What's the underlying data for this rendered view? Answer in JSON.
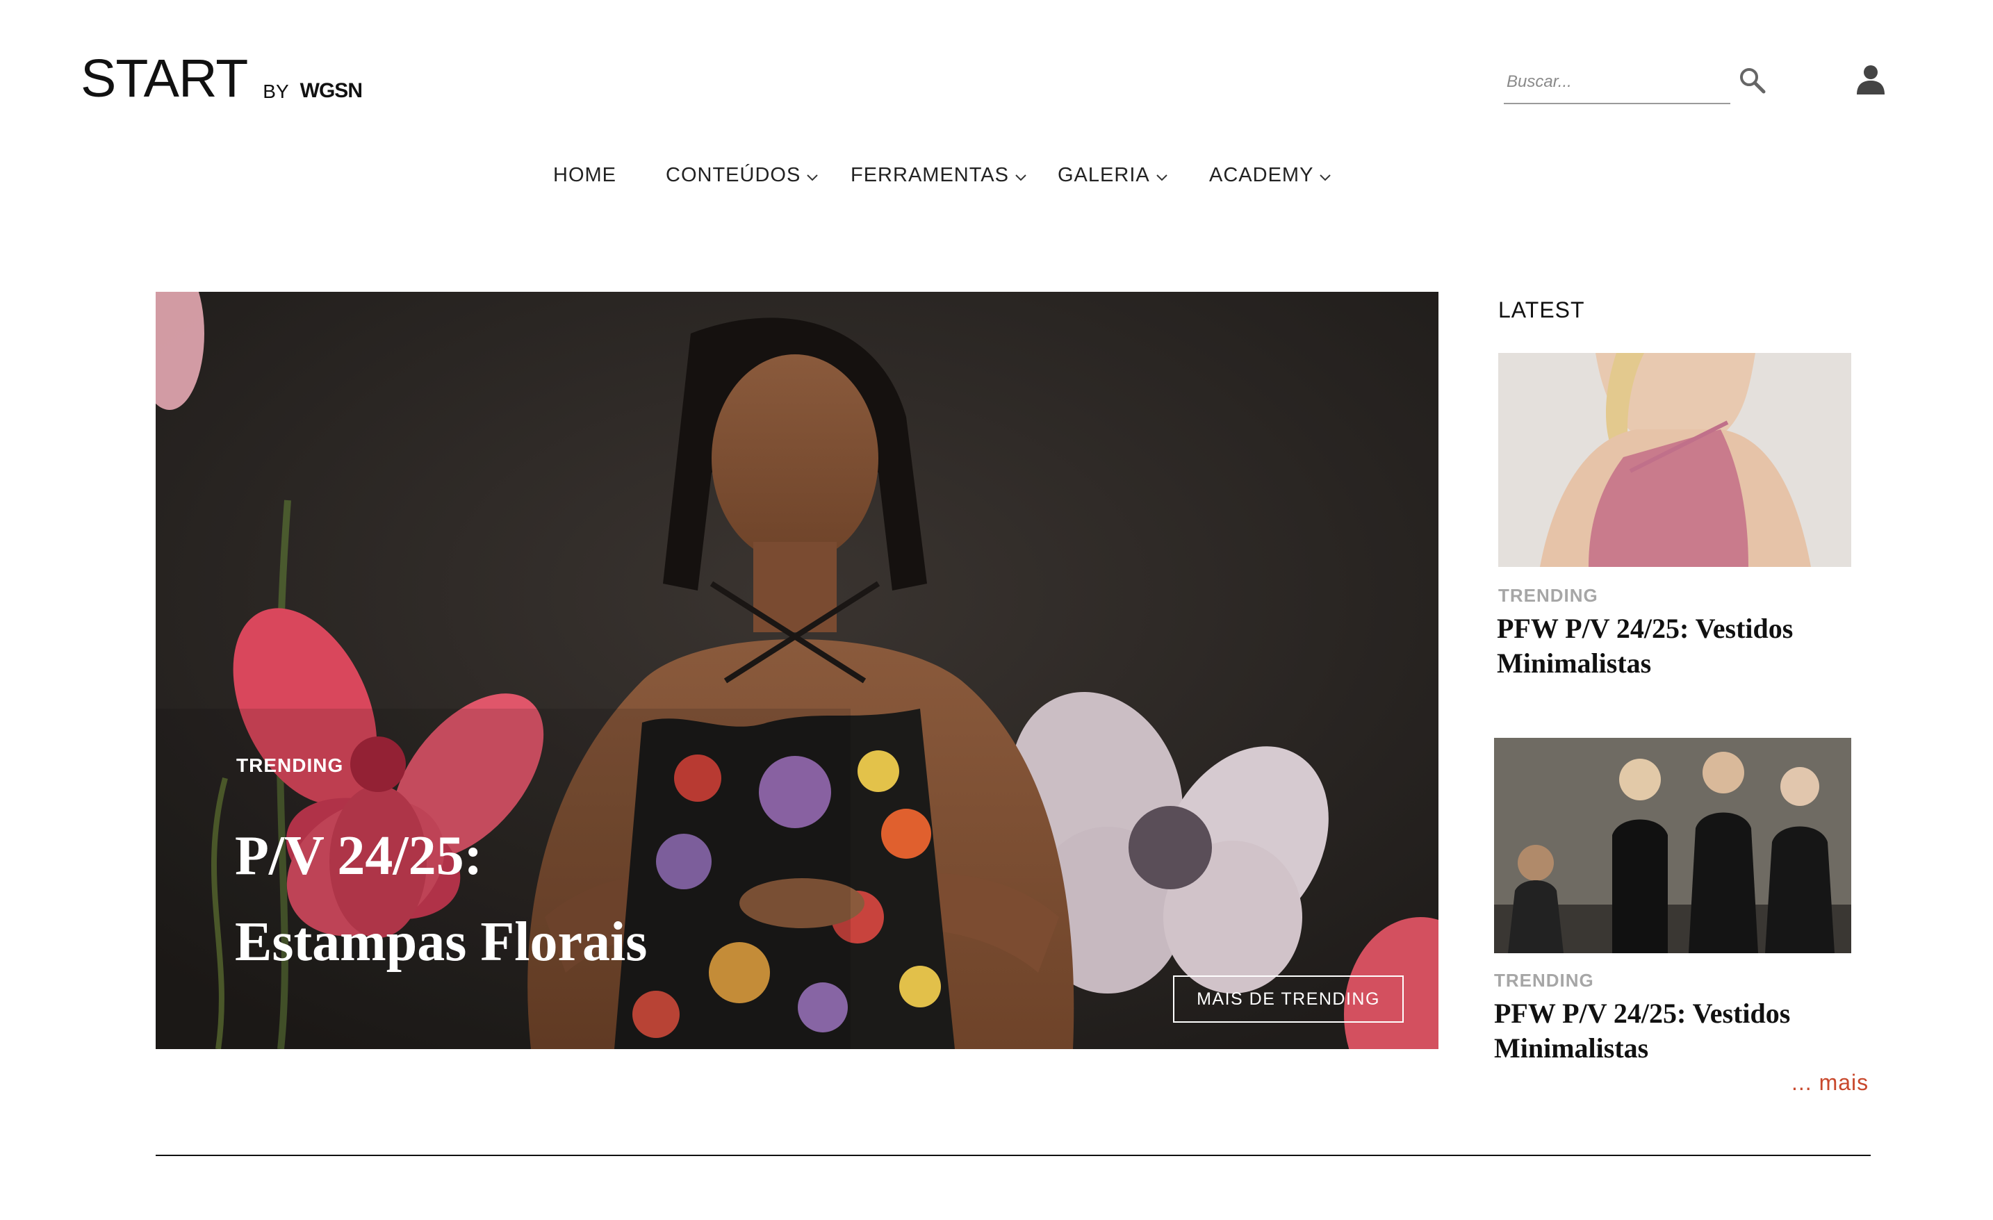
{
  "header": {
    "logo_main": "START",
    "logo_by": "BY",
    "logo_brand": "WGSN",
    "search_placeholder": "Buscar..."
  },
  "nav": {
    "items": [
      {
        "label": "HOME",
        "has_dropdown": false
      },
      {
        "label": "CONTEÚDOS",
        "has_dropdown": true
      },
      {
        "label": "FERRAMENTAS",
        "has_dropdown": true
      },
      {
        "label": "GALERIA",
        "has_dropdown": true
      },
      {
        "label": "ACADEMY",
        "has_dropdown": true
      }
    ]
  },
  "hero": {
    "category": "TRENDING",
    "title_line1": "P/V 24/25:",
    "title_line2": "Estampas Florais",
    "button_label": "MAIS DE TRENDING"
  },
  "latest": {
    "heading": "LATEST",
    "cards": [
      {
        "category": "TRENDING",
        "title_line1": "PFW P/V 24/25: Vestidos",
        "title_line2": "Minimalistas"
      },
      {
        "category": "TRENDING",
        "title_line1": "PFW P/V 24/25: Vestidos",
        "title_line2": "Minimalistas"
      }
    ],
    "more_label": "... mais"
  },
  "colors": {
    "accent": "#c8482c",
    "category_gray": "#a6a6a6",
    "text": "#111111",
    "hero_bg": "#2b2724"
  },
  "icons": [
    "search-icon",
    "user-icon",
    "chevron-down-icon"
  ]
}
